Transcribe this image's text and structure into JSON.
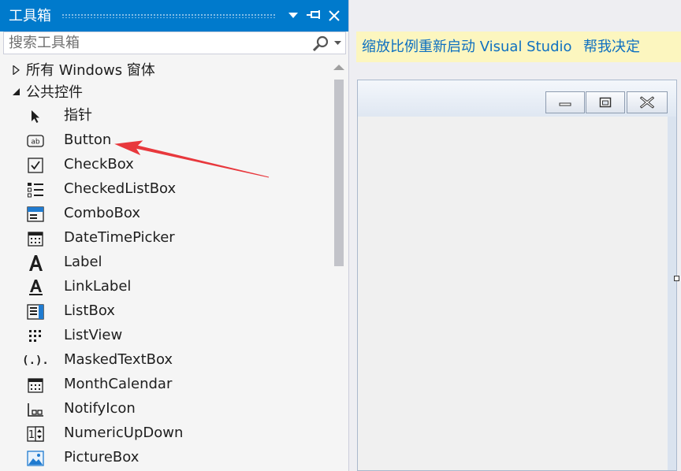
{
  "toolbox": {
    "title": "工具箱",
    "search_placeholder": "搜索工具箱",
    "groups": [
      {
        "label": "所有 Windows 窗体",
        "expanded": false
      },
      {
        "label": "公共控件",
        "expanded": true
      }
    ],
    "items": [
      {
        "label": "指针",
        "icon": "pointer-icon"
      },
      {
        "label": "Button",
        "icon": "button-icon"
      },
      {
        "label": "CheckBox",
        "icon": "checkbox-icon"
      },
      {
        "label": "CheckedListBox",
        "icon": "checked-list-icon"
      },
      {
        "label": "ComboBox",
        "icon": "combobox-icon"
      },
      {
        "label": "DateTimePicker",
        "icon": "calendar-icon"
      },
      {
        "label": "Label",
        "icon": "label-icon"
      },
      {
        "label": "LinkLabel",
        "icon": "link-label-icon"
      },
      {
        "label": "ListBox",
        "icon": "listbox-icon"
      },
      {
        "label": "ListView",
        "icon": "listview-icon"
      },
      {
        "label": "MaskedTextBox",
        "icon": "masked-textbox-icon"
      },
      {
        "label": "MonthCalendar",
        "icon": "calendar-icon"
      },
      {
        "label": "NotifyIcon",
        "icon": "notify-icon"
      },
      {
        "label": "NumericUpDown",
        "icon": "numeric-updown-icon"
      },
      {
        "label": "PictureBox",
        "icon": "picture-icon"
      }
    ],
    "button_icon_text": "ab",
    "masked_icon_text": "(.)."
  },
  "infobar": {
    "restart_link": "缩放比例重新启动 Visual Studio",
    "help_link": "帮我决定"
  },
  "colors": {
    "accent": "#007acc",
    "infobar_bg": "#fcf6bf",
    "link": "#0e70c0",
    "arrow": "#e8383d"
  }
}
